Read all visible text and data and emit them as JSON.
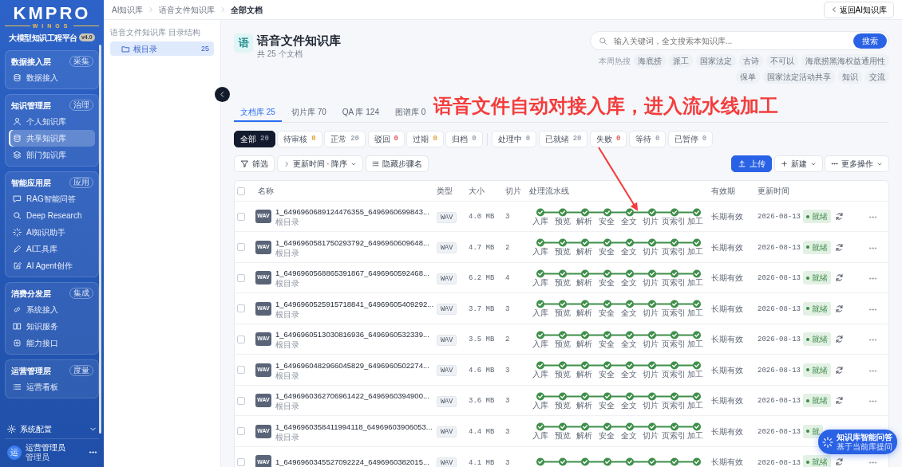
{
  "sidebar": {
    "logo": {
      "title": "KMPRO",
      "subtitle": "WINGS"
    },
    "platform": "大模型知识工程平台",
    "version": "v4.0",
    "groups": [
      {
        "title": "数据接入层",
        "badge": "采集",
        "items": [
          {
            "label": "数据接入",
            "selected": false
          }
        ]
      },
      {
        "title": "知识管理层",
        "badge": "治理",
        "items": [
          {
            "label": "个人知识库",
            "selected": false
          },
          {
            "label": "共享知识库",
            "selected": true
          },
          {
            "label": "部门知识库",
            "selected": false
          }
        ]
      },
      {
        "title": "智能应用层",
        "badge": "应用",
        "items": [
          {
            "label": "RAG智能问答",
            "selected": false
          },
          {
            "label": "Deep Research",
            "selected": false
          },
          {
            "label": "AI知识助手",
            "selected": false
          },
          {
            "label": "AI工具库",
            "selected": false
          },
          {
            "label": "AI Agent创作",
            "selected": false
          }
        ]
      },
      {
        "title": "消费分发层",
        "badge": "集成",
        "items": [
          {
            "label": "系统接入",
            "selected": false
          },
          {
            "label": "知识服务",
            "selected": false
          },
          {
            "label": "能力接口",
            "selected": false
          }
        ]
      },
      {
        "title": "运营管理层",
        "badge": "度量",
        "items": [
          {
            "label": "运营看板",
            "selected": false
          }
        ]
      }
    ],
    "settings": {
      "label": "系统配置",
      "expanded": false
    },
    "user": {
      "avatar": "运",
      "name": "运营管理员",
      "role": "管理员"
    }
  },
  "breadcrumb": [
    "AI知识库",
    "语音文件知识库",
    "全部文档"
  ],
  "back_button": "返回AI知识库",
  "tree": {
    "title": "语音文件知识库 目录结构",
    "items": [
      {
        "label": "根目录",
        "count": "25",
        "selected": true
      }
    ]
  },
  "header": {
    "icon": "语",
    "title": "语音文件知识库",
    "subtitle": "共 25 个文档"
  },
  "search": {
    "placeholder": "输入关键词，全文搜索本知识库...",
    "button": "搜索"
  },
  "hot_search": {
    "label": "本周热搜",
    "tags": [
      "海底捞",
      "派工",
      "国家法定",
      "古诗",
      "不可以",
      "海底捞黑海权益通用性",
      "保单",
      "国家法定活动共享",
      "知识",
      "交流"
    ]
  },
  "annotation": {
    "text": "语音文件自动对接入库，进入流水线加工"
  },
  "tabs": [
    {
      "label": "文档库 25",
      "selected": true
    },
    {
      "label": "切片库 70",
      "selected": false
    },
    {
      "label": "QA 库 124",
      "selected": false
    },
    {
      "label": "图谱库 0",
      "selected": false
    }
  ],
  "status_filters": [
    {
      "label": "全部",
      "count": "20",
      "selected": true,
      "color": "#8a93a3"
    },
    {
      "label": "待审核",
      "count": "0",
      "selected": false,
      "color": "#e0a33a"
    },
    {
      "label": "正常",
      "count": "20",
      "selected": false,
      "color": "#9aa3b0"
    },
    {
      "label": "驳回",
      "count": "0",
      "selected": false,
      "color": "#e05a5a"
    },
    {
      "label": "过期",
      "count": "0",
      "selected": false,
      "color": "#e0a33a"
    },
    {
      "label": "归档",
      "count": "0",
      "selected": false,
      "color": "#9aa3b0"
    }
  ],
  "process_filters": [
    {
      "label": "处理中",
      "count": "0",
      "selected": false,
      "color": "#9aa3b0"
    },
    {
      "label": "已就绪",
      "count": "20",
      "selected": false,
      "color": "#9aa3b0"
    },
    {
      "label": "失败",
      "count": "0",
      "selected": false,
      "color": "#e05a5a"
    },
    {
      "label": "等待",
      "count": "0",
      "selected": false,
      "color": "#9aa3b0"
    },
    {
      "label": "已暂停",
      "count": "0",
      "selected": false,
      "color": "#9aa3b0"
    }
  ],
  "toolbar": {
    "filter": "筛选",
    "sort": "更新时间 · 降序",
    "hide_steps": "隐藏步骤名",
    "upload": "上传",
    "new": "新建",
    "more": "更多操作"
  },
  "table": {
    "select_all_checked": false,
    "columns": [
      "名称",
      "类型",
      "大小",
      "切片",
      "处理流水线",
      "有效期",
      "更新时间"
    ],
    "rows": [
      {
        "checked": false,
        "file_icon": "WAV",
        "name": "1_6496960689124476355_6496960699843...",
        "folder": "根目录",
        "type": "WAV",
        "size": "4.0 MB",
        "slices": "3",
        "steps": [
          {
            "label": "入库",
            "done": true
          },
          {
            "label": "预览",
            "done": true
          },
          {
            "label": "解析",
            "done": true
          },
          {
            "label": "安全",
            "done": true
          },
          {
            "label": "全文",
            "done": true
          },
          {
            "label": "切片",
            "done": true
          },
          {
            "label": "页索引",
            "done": true
          },
          {
            "label": "加工",
            "done": true
          }
        ],
        "validity": "长期有效",
        "updated": "2026-08-13",
        "status": "就绪"
      },
      {
        "checked": false,
        "file_icon": "WAV",
        "name": "1_6496960581750293792_6496960609648...",
        "folder": "根目录",
        "type": "WAV",
        "size": "4.7 MB",
        "slices": "2",
        "steps": [
          {
            "label": "入库",
            "done": true
          },
          {
            "label": "预览",
            "done": true
          },
          {
            "label": "解析",
            "done": true
          },
          {
            "label": "安全",
            "done": true
          },
          {
            "label": "全文",
            "done": true
          },
          {
            "label": "切片",
            "done": true
          },
          {
            "label": "页索引",
            "done": true
          },
          {
            "label": "加工",
            "done": true
          }
        ],
        "validity": "长期有效",
        "updated": "2026-08-13",
        "status": "就绪"
      },
      {
        "checked": false,
        "file_icon": "WAV",
        "name": "1_6496960568865391867_6496960592468...",
        "folder": "根目录",
        "type": "WAV",
        "size": "6.2 MB",
        "slices": "4",
        "steps": [
          {
            "label": "入库",
            "done": true
          },
          {
            "label": "预览",
            "done": true
          },
          {
            "label": "解析",
            "done": true
          },
          {
            "label": "安全",
            "done": true
          },
          {
            "label": "全文",
            "done": true
          },
          {
            "label": "切片",
            "done": true
          },
          {
            "label": "页索引",
            "done": true
          },
          {
            "label": "加工",
            "done": true
          }
        ],
        "validity": "长期有效",
        "updated": "2026-08-13",
        "status": "就绪"
      },
      {
        "checked": false,
        "file_icon": "WAV",
        "name": "1_6496960525915718841_64969605409292...",
        "folder": "根目录",
        "type": "WAV",
        "size": "3.7 MB",
        "slices": "3",
        "steps": [
          {
            "label": "入库",
            "done": true
          },
          {
            "label": "预览",
            "done": true
          },
          {
            "label": "解析",
            "done": true
          },
          {
            "label": "安全",
            "done": true
          },
          {
            "label": "全文",
            "done": true
          },
          {
            "label": "切片",
            "done": true
          },
          {
            "label": "页索引",
            "done": true
          },
          {
            "label": "加工",
            "done": true
          }
        ],
        "validity": "长期有效",
        "updated": "2026-08-13",
        "status": "就绪"
      },
      {
        "checked": false,
        "file_icon": "WAV",
        "name": "1_6496960513030816936_6496960532339...",
        "folder": "根目录",
        "type": "WAV",
        "size": "3.5 MB",
        "slices": "2",
        "steps": [
          {
            "label": "入库",
            "done": true
          },
          {
            "label": "预览",
            "done": true
          },
          {
            "label": "解析",
            "done": true
          },
          {
            "label": "安全",
            "done": true
          },
          {
            "label": "全文",
            "done": true
          },
          {
            "label": "切片",
            "done": true
          },
          {
            "label": "页索引",
            "done": true
          },
          {
            "label": "加工",
            "done": true
          }
        ],
        "validity": "长期有效",
        "updated": "2026-08-13",
        "status": "就绪"
      },
      {
        "checked": false,
        "file_icon": "WAV",
        "name": "1_6496960482966045829_6496960502274...",
        "folder": "根目录",
        "type": "WAV",
        "size": "4.6 MB",
        "slices": "3",
        "steps": [
          {
            "label": "入库",
            "done": true
          },
          {
            "label": "预览",
            "done": true
          },
          {
            "label": "解析",
            "done": true
          },
          {
            "label": "安全",
            "done": true
          },
          {
            "label": "全文",
            "done": true
          },
          {
            "label": "切片",
            "done": true
          },
          {
            "label": "页索引",
            "done": true
          },
          {
            "label": "加工",
            "done": true
          }
        ],
        "validity": "长期有效",
        "updated": "2026-08-13",
        "status": "就绪"
      },
      {
        "checked": false,
        "file_icon": "WAV",
        "name": "1_6496960362706961422_6496960394900...",
        "folder": "根目录",
        "type": "WAV",
        "size": "3.6 MB",
        "slices": "3",
        "steps": [
          {
            "label": "入库",
            "done": true
          },
          {
            "label": "预览",
            "done": true
          },
          {
            "label": "解析",
            "done": true
          },
          {
            "label": "安全",
            "done": true
          },
          {
            "label": "全文",
            "done": true
          },
          {
            "label": "切片",
            "done": true
          },
          {
            "label": "页索引",
            "done": true
          },
          {
            "label": "加工",
            "done": true
          }
        ],
        "validity": "长期有效",
        "updated": "2026-08-13",
        "status": "就绪"
      },
      {
        "checked": false,
        "file_icon": "WAV",
        "name": "1_6496960358411994118_64969603906053...",
        "folder": "根目录",
        "type": "WAV",
        "size": "4.4 MB",
        "slices": "3",
        "steps": [
          {
            "label": "入库",
            "done": true
          },
          {
            "label": "预览",
            "done": true
          },
          {
            "label": "解析",
            "done": true
          },
          {
            "label": "安全",
            "done": true
          },
          {
            "label": "全文",
            "done": true
          },
          {
            "label": "切片",
            "done": true
          },
          {
            "label": "页索引",
            "done": true
          },
          {
            "label": "加工",
            "done": true
          }
        ],
        "validity": "长期有效",
        "updated": "2026-08-13",
        "status": "就"
      },
      {
        "checked": false,
        "file_icon": "WAV",
        "name": "1_6496960345527092224_6496960382015...",
        "type": "WAV",
        "size": "4.1 MB",
        "slices": "3",
        "steps": [
          {
            "done": true
          },
          {
            "done": true
          },
          {
            "done": true
          },
          {
            "done": true
          },
          {
            "done": true
          },
          {
            "done": true
          },
          {
            "done": true
          },
          {
            "done": true
          }
        ],
        "validity": "长期有效",
        "updated": "2026-08-13",
        "status": "就绪"
      }
    ]
  },
  "assistant_button": {
    "title": "知识库智能问答",
    "subtitle": "基于当前库提问"
  }
}
